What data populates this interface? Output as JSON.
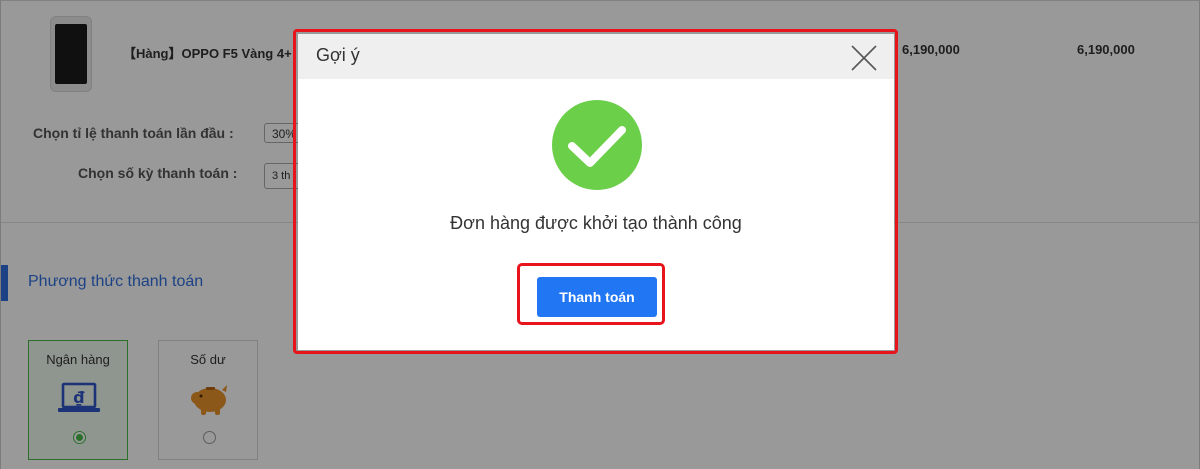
{
  "product": {
    "name": "【Hàng】OPPO F5 Vàng 4+",
    "unit_price": "6,190,000",
    "total_price": "6,190,000"
  },
  "installment": {
    "down_payment_label": "Chọn tỉ lệ thanh toán lần đầu :",
    "down_payment_value": "30%",
    "term_label": "Chọn số kỳ thanh toán :",
    "term_value": "3 th"
  },
  "payment_method": {
    "section_title": "Phương thức thanh toán",
    "options": [
      {
        "label": "Ngân hàng",
        "icon": "bank-laptop-icon",
        "selected": true
      },
      {
        "label": "Số dư",
        "icon": "piggy-bank-icon",
        "selected": false
      }
    ]
  },
  "modal": {
    "title": "Gợi ý",
    "message": "Đơn hàng được khởi tạo thành công",
    "button_label": "Thanh toán",
    "icon": "success-check-icon"
  },
  "colors": {
    "accent_blue": "#2176f3",
    "success_green": "#6bcf4a",
    "highlight_red": "#e8141c",
    "selected_green": "#46b946"
  }
}
